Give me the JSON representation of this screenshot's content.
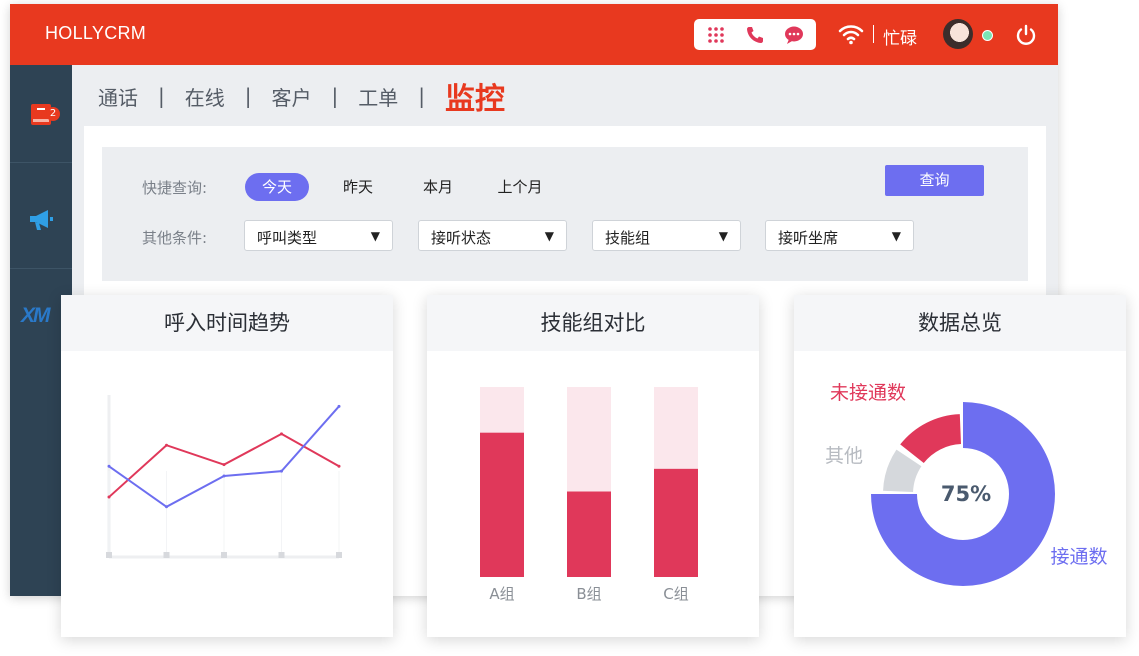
{
  "header": {
    "brand": "HOLLYCRM",
    "status": "忙碌",
    "colors": {
      "bar": "#e8391f",
      "accent": "#6d6ef0"
    },
    "toolbox_icons": [
      "dialpad-icon",
      "phone-icon",
      "chat-icon"
    ]
  },
  "sidebar": {
    "items": [
      {
        "icon": "book-icon",
        "badge": "2"
      },
      {
        "icon": "megaphone-icon"
      },
      {
        "icon": "xm-logo",
        "label": "XM"
      }
    ]
  },
  "nav": {
    "tabs": [
      {
        "label": "通话"
      },
      {
        "label": "在线"
      },
      {
        "label": "客户"
      },
      {
        "label": "工单"
      },
      {
        "label": "监控",
        "active": true
      }
    ],
    "separator": "|"
  },
  "filter": {
    "quick_label": "快捷查询:",
    "other_label": "其他条件:",
    "quick_options": [
      "今天",
      "昨天",
      "本月",
      "上个月"
    ],
    "selected_quick": "今天",
    "search_button": "查询",
    "selects": [
      {
        "value": "呼叫类型",
        "caret": "▼"
      },
      {
        "value": "接听状态",
        "caret": "▼"
      },
      {
        "value": "技能组",
        "caret": "▼"
      },
      {
        "value": "接听坐席",
        "caret": "▼"
      }
    ]
  },
  "cards": {
    "trend_title": "呼入时间趋势",
    "skill_title": "技能组对比",
    "overview_title": "数据总览"
  },
  "chart_data": [
    {
      "type": "line",
      "title": "呼入时间趋势",
      "x": [
        1,
        2,
        3,
        4,
        5
      ],
      "series": [
        {
          "color": "#e0385a",
          "values": [
            37,
            69,
            57,
            76,
            56
          ]
        },
        {
          "color": "#6d6ef0",
          "values": [
            56,
            31,
            50,
            53,
            93
          ]
        }
      ],
      "ylim": [
        0,
        100
      ],
      "grid": false
    },
    {
      "type": "bar",
      "title": "技能组对比",
      "categories": [
        "A组",
        "B组",
        "C组"
      ],
      "series": [
        {
          "color": "#e0385a",
          "values": [
            76,
            45,
            57
          ]
        },
        {
          "color": "#fbe7ec",
          "values": [
            24,
            55,
            43
          ]
        }
      ],
      "stacked": true,
      "ylim": [
        0,
        100
      ]
    },
    {
      "type": "pie",
      "title": "数据总览",
      "center_label": "75%",
      "slices": [
        {
          "label": "接通数",
          "value": 75,
          "color": "#6d6ef0"
        },
        {
          "label": "其他",
          "value": 10,
          "color": "#d5d8dc"
        },
        {
          "label": "未接通数",
          "value": 15,
          "color": "#e0385a"
        }
      ]
    }
  ]
}
